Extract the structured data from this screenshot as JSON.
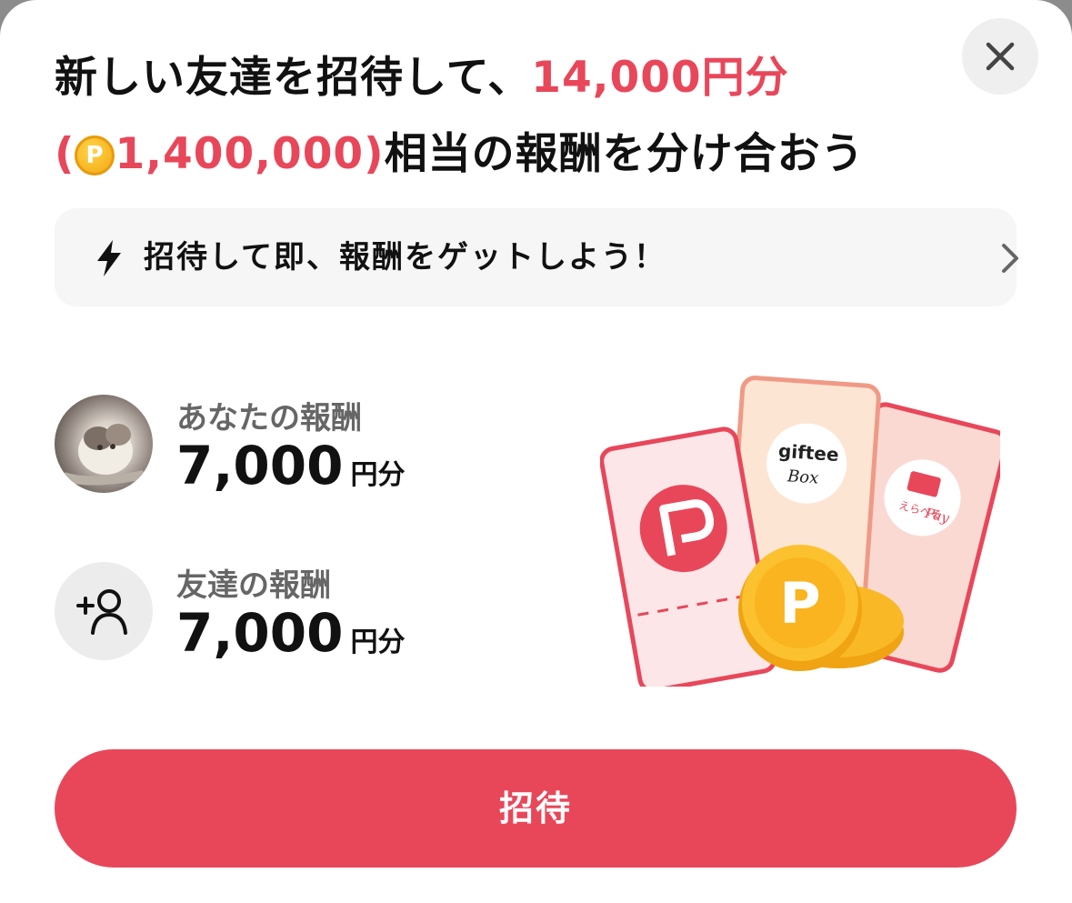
{
  "title": {
    "line1_prefix": "新しい友達を招待して、",
    "line1_highlight": "14,000円分",
    "line2_open": "(",
    "line2_points": "1,400,000)",
    "line2_suffix": "相当の報酬を分け合おう",
    "coin_letter": "P"
  },
  "banner": {
    "text": "招待して即、報酬をゲットしよう！",
    "icon": "lightning-bolt-icon",
    "chevron_icon": "chevron-right-icon"
  },
  "your_reward": {
    "label": "あなたの報酬",
    "amount": "7,000",
    "unit": "円分"
  },
  "friend_reward": {
    "label": "友達の報酬",
    "amount": "7,000",
    "unit": "円分"
  },
  "illustration": {
    "ticket_brand_1": "giftee",
    "ticket_brand_1_sub": "Box",
    "ticket_brand_2_small": "えらべる",
    "ticket_brand_2": "Pay",
    "coin_letter": "P"
  },
  "cta": {
    "label": "招待"
  },
  "colors": {
    "accent": "#e8475a",
    "background": "#ffffff",
    "banner_bg": "#f6f6f6"
  }
}
